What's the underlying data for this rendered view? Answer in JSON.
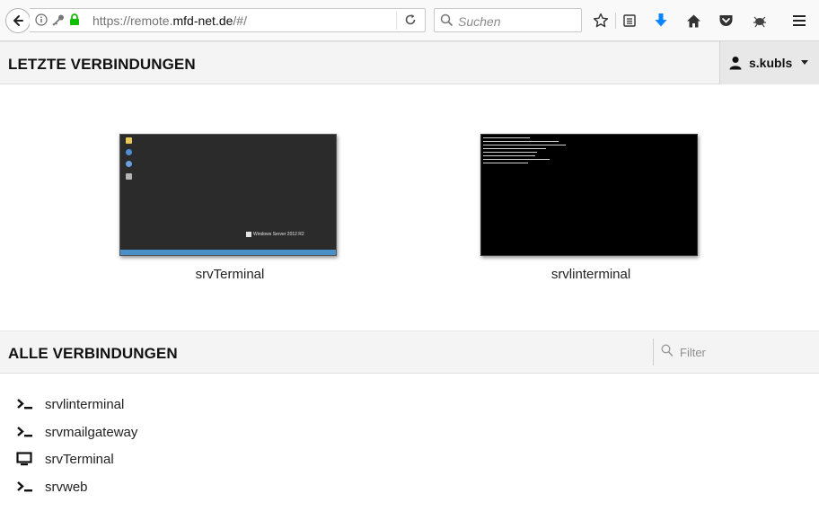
{
  "browser": {
    "url_prefix": "https://remote.",
    "url_host": "mfd-net.de",
    "url_suffix": "/#/",
    "search_placeholder": "Suchen"
  },
  "recent": {
    "title": "LETZTE VERBINDUNGEN",
    "items": [
      {
        "label": "srvTerminal",
        "preview": "windows-desktop",
        "desktop_brand": "Windows Server 2012 R2"
      },
      {
        "label": "srvlinterminal",
        "preview": "terminal-console"
      }
    ]
  },
  "user": {
    "name": "s.kubls"
  },
  "all": {
    "title": "ALLE VERBINDUNGEN",
    "filter_placeholder": "Filter",
    "items": [
      {
        "label": "srvlinterminal",
        "icon": "terminal-icon"
      },
      {
        "label": "srvmailgateway",
        "icon": "terminal-icon"
      },
      {
        "label": "srvTerminal",
        "icon": "monitor-icon"
      },
      {
        "label": "srvweb",
        "icon": "terminal-icon"
      }
    ]
  },
  "colors": {
    "secure_lock": "#12bc00",
    "download_arrow": "#0a84ff",
    "header_bg": "#f4f4f4",
    "taskbar": "#4a90c8"
  }
}
